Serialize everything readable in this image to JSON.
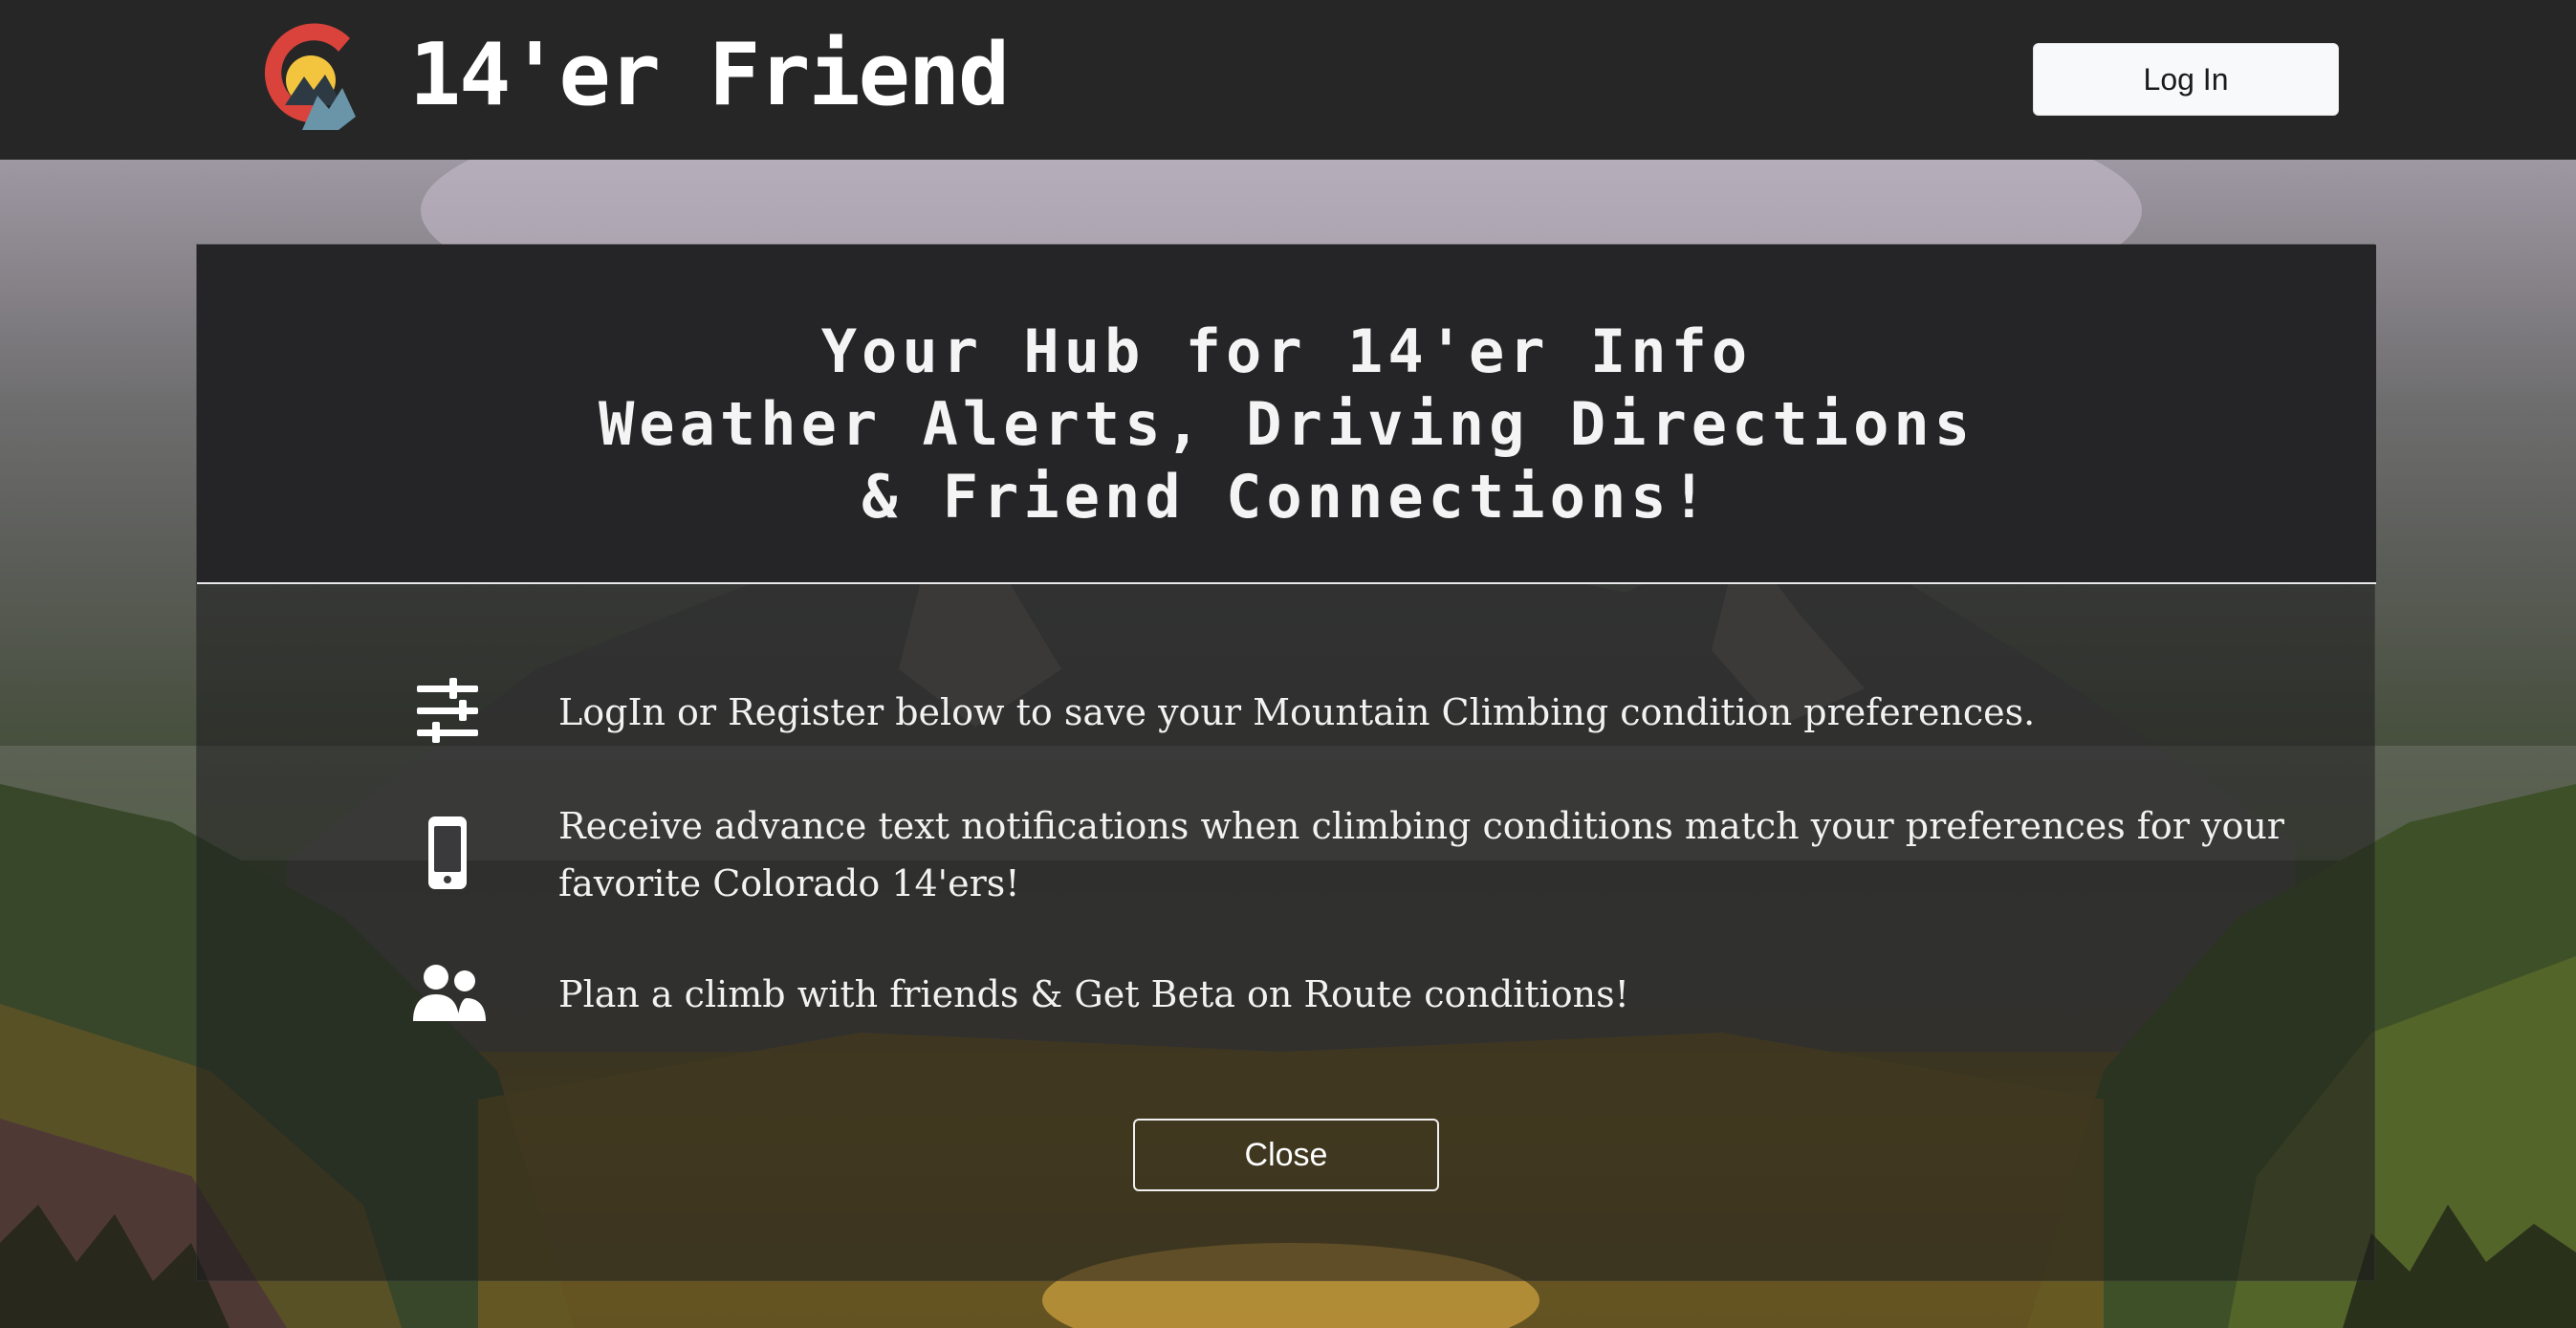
{
  "header": {
    "brand": "14'er Friend",
    "logo_icon": "mountain-logo-icon",
    "login_label": "Log In"
  },
  "modal": {
    "title_lines": [
      "Your Hub for 14'er Info",
      "Weather Alerts, Driving Directions",
      "& Friend Connections!"
    ],
    "features": [
      {
        "icon": "sliders-icon",
        "text": "LogIn or Register below to save your Mountain Climbing condition preferences."
      },
      {
        "icon": "mobile-phone-icon",
        "text": "Receive advance text notifications when climbing conditions match your preferences for your favorite Colorado 14'ers!"
      },
      {
        "icon": "users-icon",
        "text": "Plan a climb with friends & Get Beta on Route conditions!"
      }
    ],
    "close_label": "Close"
  },
  "colors": {
    "topbar": "#262626",
    "modal_header": "#252426",
    "logo_red": "#d9433b",
    "logo_yellow": "#f3c43d",
    "logo_blue": "#6a94a8"
  }
}
